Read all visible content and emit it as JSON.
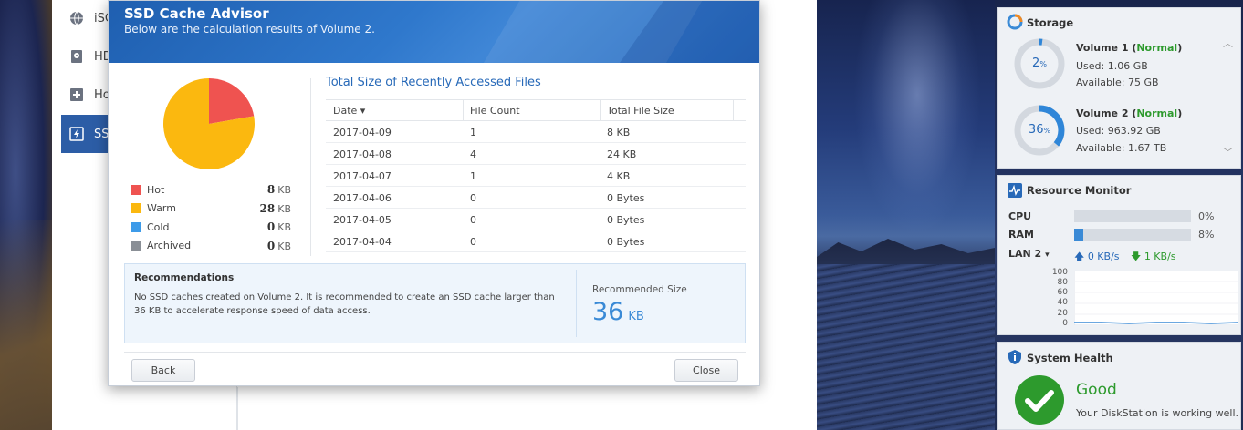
{
  "background_app": {
    "sidebar_items": [
      {
        "label": "iSC",
        "icon": "globe-icon"
      },
      {
        "label": "HD",
        "icon": "disk-icon"
      },
      {
        "label": "Hot",
        "icon": "hot-spare-icon"
      },
      {
        "label": "SSD",
        "icon": "ssd-cache-icon",
        "active": true
      }
    ]
  },
  "dialog": {
    "title": "SSD Cache Advisor",
    "subtitle": "Below are the calculation results of Volume 2.",
    "legend": [
      {
        "name": "Hot",
        "value": "8",
        "unit": "KB",
        "color": "#ef5350"
      },
      {
        "name": "Warm",
        "value": "28",
        "unit": "KB",
        "color": "#fbb80f"
      },
      {
        "name": "Cold",
        "value": "0",
        "unit": "KB",
        "color": "#3d9be9"
      },
      {
        "name": "Archived",
        "value": "0",
        "unit": "KB",
        "color": "#8a8f96"
      }
    ],
    "table": {
      "title": "Total Size of Recently Accessed Files",
      "columns": [
        "Date",
        "File Count",
        "Total File Size"
      ],
      "sort_indicator": "▾",
      "rows": [
        [
          "2017-04-09",
          "1",
          "8 KB"
        ],
        [
          "2017-04-08",
          "4",
          "24 KB"
        ],
        [
          "2017-04-07",
          "1",
          "4 KB"
        ],
        [
          "2017-04-06",
          "0",
          "0 Bytes"
        ],
        [
          "2017-04-05",
          "0",
          "0 Bytes"
        ],
        [
          "2017-04-04",
          "0",
          "0 Bytes"
        ]
      ]
    },
    "recommendations": {
      "title": "Recommendations",
      "text": "No SSD caches created on Volume 2. It is recommended to create an SSD cache larger than 36 KB to accelerate response speed of data access.",
      "size_label": "Recommended Size",
      "size_value": "36",
      "size_unit": "KB"
    },
    "buttons": {
      "back": "Back",
      "close": "Close"
    }
  },
  "widgets": {
    "storage": {
      "title": "Storage",
      "volumes": [
        {
          "name": "Volume 1",
          "status": "Normal",
          "percent": "2",
          "percent_fraction": 0.02,
          "used": "Used: 1.06 GB",
          "available": "Available: 75 GB"
        },
        {
          "name": "Volume 2",
          "status": "Normal",
          "percent": "36",
          "percent_fraction": 0.36,
          "used": "Used: 963.92 GB",
          "available": "Available: 1.67 TB"
        }
      ]
    },
    "resource_monitor": {
      "title": "Resource Monitor",
      "cpu_label": "CPU",
      "cpu_value": "0%",
      "cpu_fraction": 0.0,
      "ram_label": "RAM",
      "ram_value": "8%",
      "ram_fraction": 0.08,
      "lan_label": "LAN 2",
      "upload": "0 KB/s",
      "download": "1 KB/s",
      "axis_ticks": [
        "100",
        "80",
        "60",
        "40",
        "20",
        "0"
      ]
    },
    "system_health": {
      "title": "System Health",
      "status": "Good",
      "message": "Your DiskStation is working well.",
      "status_color": "#2d9a2d"
    }
  },
  "chart_data": {
    "type": "pie",
    "categories": [
      "Hot",
      "Warm",
      "Cold",
      "Archived"
    ],
    "values": [
      8,
      28,
      0,
      0
    ],
    "colors": [
      "#ef5350",
      "#fbb80f",
      "#3d9be9",
      "#8a8f96"
    ]
  }
}
